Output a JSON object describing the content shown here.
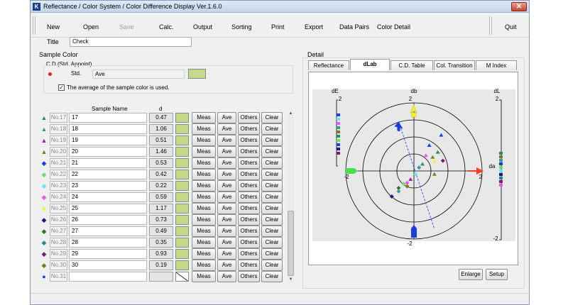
{
  "window": {
    "title": "Reflectance / Color System / Color Difference Display    Ver.1.6.0",
    "app_icon": "K",
    "close_glyph": "✕"
  },
  "menu": {
    "items": [
      {
        "label": "New",
        "enabled": true
      },
      {
        "label": "Open",
        "enabled": true
      },
      {
        "label": "Save",
        "enabled": false
      },
      {
        "label": "Calc.",
        "enabled": true
      },
      {
        "label": "Output",
        "enabled": true
      },
      {
        "label": "Sorting",
        "enabled": true
      },
      {
        "label": "Print",
        "enabled": true
      },
      {
        "label": "Export",
        "enabled": true
      },
      {
        "label": "Data Pairs",
        "enabled": true
      },
      {
        "label": "Color Detail",
        "enabled": true
      }
    ],
    "quit": "Quit"
  },
  "title_field": {
    "label": "Title",
    "value": "Check"
  },
  "sample_color": {
    "heading": "Sample Color",
    "group_label": "C.D.(Std. Appoint)",
    "std_label": "Std.",
    "std_value": "Ave",
    "swatch_color": "#c4d88a",
    "checkbox_label": "The average of the sample color is used.",
    "checked": true
  },
  "table": {
    "col_name": "Sample Name",
    "col_d": "d",
    "rows": [
      {
        "no": "No.17",
        "name": "17",
        "d": "0.47",
        "color": "#2e8b57",
        "mark": "▲"
      },
      {
        "no": "No.18",
        "name": "18",
        "d": "1.06",
        "color": "#3a9a9a",
        "mark": "▲"
      },
      {
        "no": "No.19",
        "name": "19",
        "d": "0.51",
        "color": "#8e2a8e",
        "mark": "▲"
      },
      {
        "no": "No.20",
        "name": "20",
        "d": "1.46",
        "color": "#7a7a2a",
        "mark": "▲"
      },
      {
        "no": "No.21",
        "name": "21",
        "d": "0.53",
        "color": "#1a3fe0",
        "mark": "◆"
      },
      {
        "no": "No.22",
        "name": "22",
        "d": "0.42",
        "color": "#66e066",
        "mark": "◆"
      },
      {
        "no": "No.23",
        "name": "23",
        "d": "0.22",
        "color": "#66e8f0",
        "mark": "◆"
      },
      {
        "no": "No.24",
        "name": "24",
        "d": "0.59",
        "color": "#f050f0",
        "mark": "◆"
      },
      {
        "no": "No.25",
        "name": "25",
        "d": "1.17",
        "color": "#f0f050",
        "mark": "◆"
      },
      {
        "no": "No.26",
        "name": "26",
        "d": "0.73",
        "color": "#1a1a8a",
        "mark": "◆"
      },
      {
        "no": "No.27",
        "name": "27",
        "d": "0.49",
        "color": "#2a7a2a",
        "mark": "◆"
      },
      {
        "no": "No.28",
        "name": "28",
        "d": "0.35",
        "color": "#2a8a8a",
        "mark": "◆"
      },
      {
        "no": "No.29",
        "name": "29",
        "d": "0.93",
        "color": "#7a1a7a",
        "mark": "◆"
      },
      {
        "no": "No.30",
        "name": "30",
        "d": "0.19",
        "color": "#7a7a1a",
        "mark": "◆"
      },
      {
        "no": "No.31",
        "name": "",
        "d": "",
        "color": "#1a3fe0",
        "mark": "●"
      }
    ],
    "btn_meas": "Meas",
    "btn_ave": "Ave",
    "btn_others": "Others",
    "btn_clear": "Clear"
  },
  "detail": {
    "heading": "Detail",
    "tabs": [
      "Reflectance",
      "dLab",
      "C.D. Table",
      "Col. Transition",
      "M Index"
    ],
    "active_tab": "dLab",
    "enlarge": "Enlarge",
    "setup": "Setup"
  },
  "chart_data": {
    "type": "scatter",
    "title": "",
    "xlabel": "da",
    "ylabel": "db",
    "xlim": [
      -2,
      2
    ],
    "ylim": [
      -2,
      2
    ],
    "ring_radii": [
      0.5,
      1,
      1.5,
      2
    ],
    "tick_labels": {
      "db_top": "2",
      "db_bottom": "-2",
      "da_left": "-2",
      "da_right": "2",
      "de_label": "dE",
      "de_top": "2",
      "dl_label": "dL",
      "dl_top": "2",
      "dl_bottom": "-2"
    },
    "points": [
      {
        "a": 0.45,
        "b": 0.75,
        "color": "#1a3fe0",
        "shape": "tri"
      },
      {
        "a": 0.7,
        "b": 0.55,
        "color": "#2e8b57",
        "shape": "tri"
      },
      {
        "a": 0.35,
        "b": 0.45,
        "color": "#f050f0",
        "shape": "tri"
      },
      {
        "a": 0.55,
        "b": 0.4,
        "color": "#7a7a2a",
        "shape": "tri"
      },
      {
        "a": 0.6,
        "b": 0.28,
        "color": "#f0f050",
        "shape": "dia"
      },
      {
        "a": 0.85,
        "b": 0.3,
        "color": "#7a1a7a",
        "shape": "dia"
      },
      {
        "a": 0.25,
        "b": 0.2,
        "color": "#2a8a8a",
        "shape": "tri"
      },
      {
        "a": 0.15,
        "b": 0.1,
        "color": "#3a9a9a",
        "shape": "dia"
      },
      {
        "a": 0.05,
        "b": -0.1,
        "color": "#66e8f0",
        "shape": "dia"
      },
      {
        "a": -0.1,
        "b": -0.25,
        "color": "#8e2a8e",
        "shape": "tri"
      },
      {
        "a": -0.2,
        "b": -0.35,
        "color": "#f050f0",
        "shape": "dia"
      },
      {
        "a": -0.3,
        "b": -0.38,
        "color": "#66e066",
        "shape": "dia"
      },
      {
        "a": -0.45,
        "b": -0.5,
        "color": "#2a7a2a",
        "shape": "dia"
      },
      {
        "a": -0.45,
        "b": -0.6,
        "color": "#3a9a9a",
        "shape": "dia"
      },
      {
        "a": -0.65,
        "b": -0.75,
        "color": "#1a1a8a",
        "shape": "dia"
      },
      {
        "a": -0.2,
        "b": -0.45,
        "color": "#7a7a1a",
        "shape": "dia"
      },
      {
        "a": 0.6,
        "b": -0.1,
        "color": "#7a7a2a",
        "shape": "tri"
      },
      {
        "a": 0.8,
        "b": 1.05,
        "color": "#1a3fe0",
        "shape": "tri"
      }
    ],
    "vector_line": {
      "from": [
        -0.45,
        1.45
      ],
      "to": [
        0.6,
        -1.7
      ],
      "color": "#2a4aff"
    },
    "arrows": [
      {
        "name": "db-top-arrow",
        "color": "#f5f520"
      },
      {
        "name": "db-bottom-arrow",
        "color": "#1a3fe0"
      },
      {
        "name": "da-right-arrow",
        "color": "#f04020"
      },
      {
        "name": "da-left-arrow",
        "color": "#4ae04a"
      },
      {
        "name": "vector-arrow",
        "color": "#1a3fe0"
      }
    ],
    "de_markers": [
      "#1a3fe0",
      "#66e8f0",
      "#f050f0",
      "#3a9a9a",
      "#7a7a2a",
      "#2e8b57",
      "#66e066",
      "#1a3fe0",
      "#1a1a8a",
      "#7a1a7a"
    ],
    "dl_markers": [
      "#2e8b57",
      "#7a7a2a",
      "#3a9a9a",
      "#1a3fe0",
      "#66e066",
      "#66e8f0",
      "#1a1a8a",
      "#2a8a8a",
      "#7a1a7a",
      "#f050f0"
    ]
  }
}
